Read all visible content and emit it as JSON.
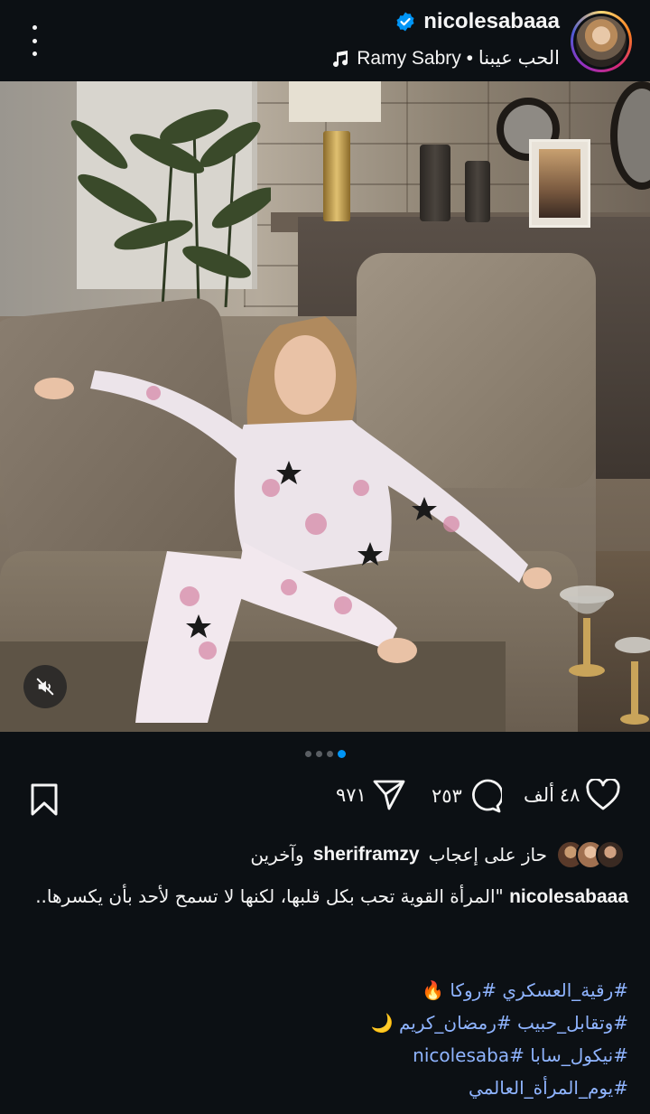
{
  "header": {
    "username": "nicolesabaaa",
    "music": "Ramy Sabry • الحب عيبنا",
    "verified": true
  },
  "post": {
    "carousel_total": 4,
    "carousel_active": 4,
    "audio": "muted"
  },
  "actions": {
    "likes_count": "٤٨ ألف",
    "comments_count": "٢٥٣",
    "shares_count": "٩٧١"
  },
  "likes": {
    "prefix": "حاز على إعجاب",
    "user": "sheriframzy",
    "suffix": "وآخرين"
  },
  "caption": {
    "user": "nicolesabaaa",
    "text": "\"المرأة القوية تحب بكل قلبها، لكنها لا تسمح لأحد بأن يكسرها..",
    "hashtag_lines": [
      "#رقية_العسكري #روكا 🔥",
      "#وتقابل_حبيب #رمضان_كريم 🌙",
      "#نيكول_سابا #nicolesaba",
      "#يوم_المرأة_العالمي"
    ]
  },
  "colors": {
    "background": "#0c1014",
    "text": "#f5f5f5",
    "hashtag": "#8fb4ff",
    "active_dot": "#0095f6",
    "verified": "#0095f6"
  }
}
